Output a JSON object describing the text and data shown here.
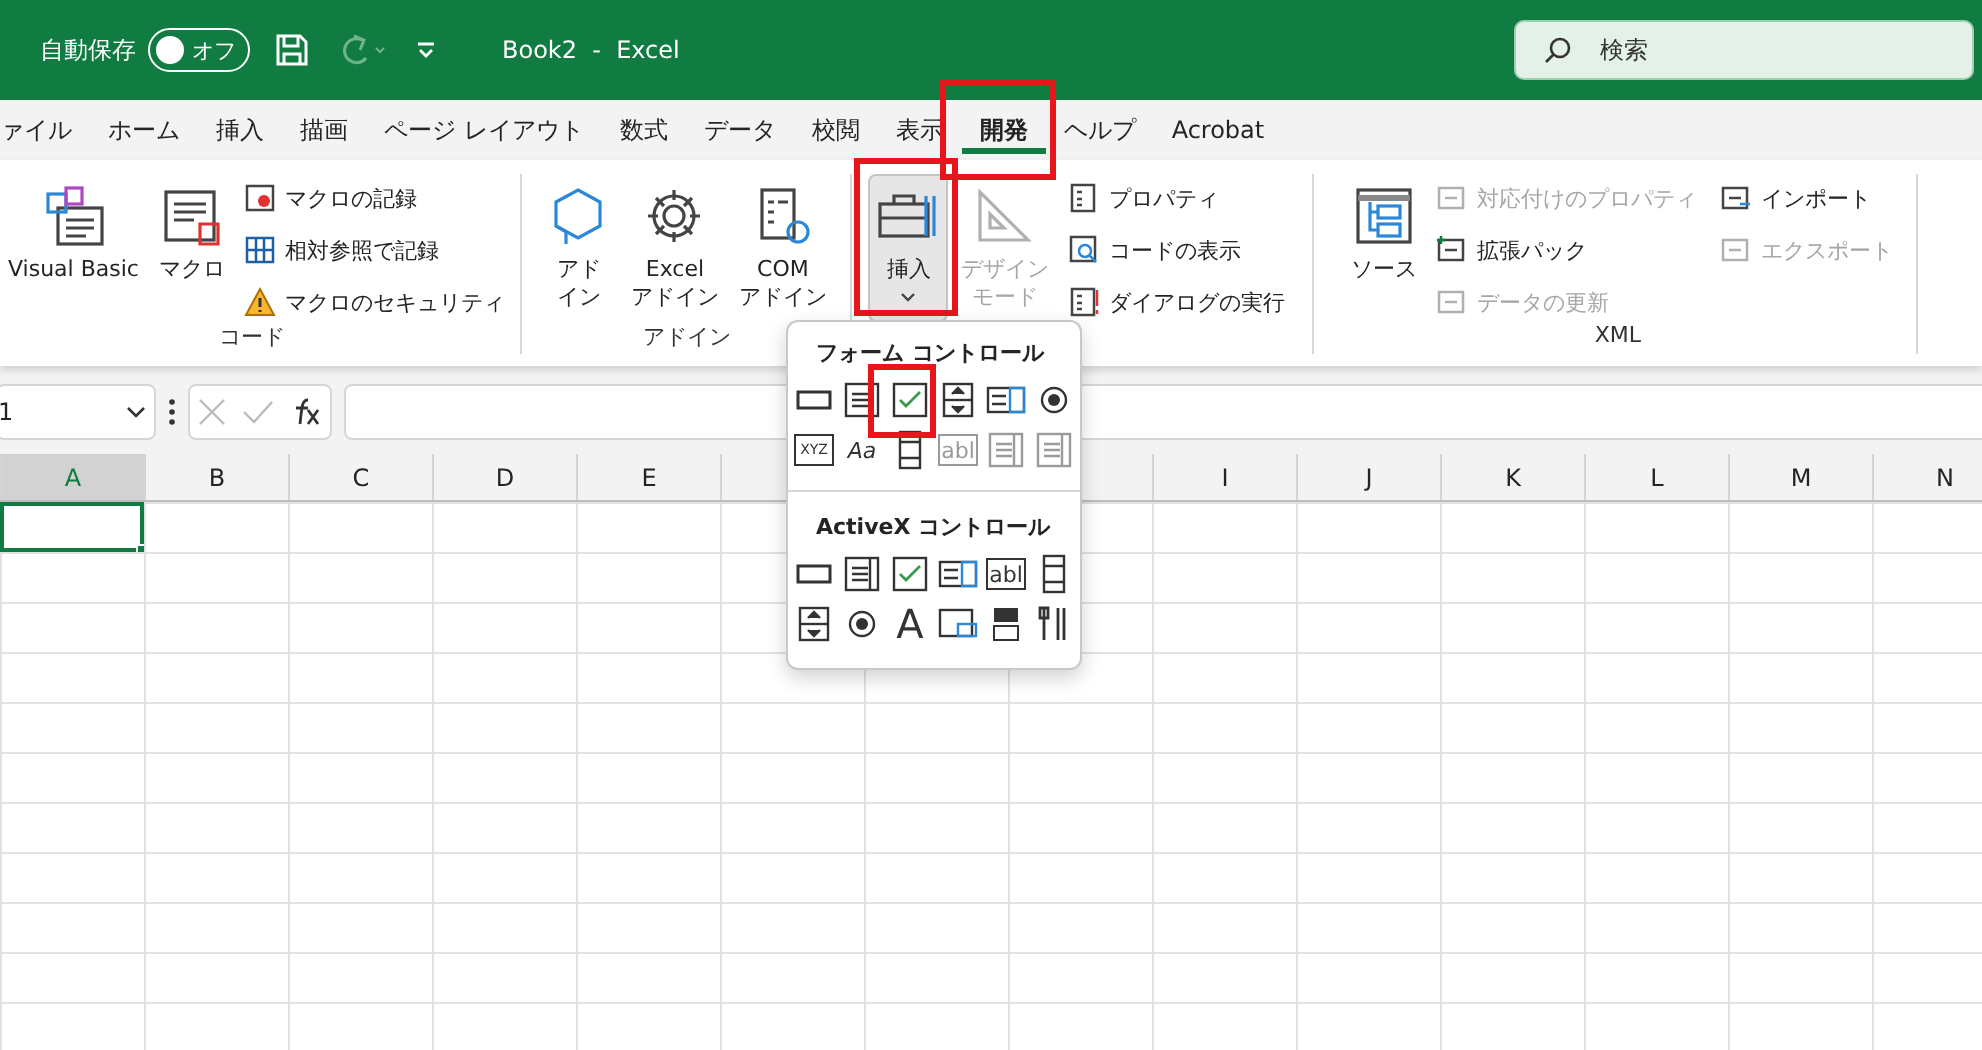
{
  "title_bar": {
    "autosave_label": "自動保存",
    "autosave_toggle": {
      "on": false,
      "label": "オフ"
    },
    "document_title": "Book2  -  Excel",
    "search": {
      "placeholder": "検索"
    }
  },
  "tabs": [
    {
      "label": "ァイル",
      "selected": false,
      "highlighted": false
    },
    {
      "label": "ホーム",
      "selected": false,
      "highlighted": false
    },
    {
      "label": "挿入",
      "selected": false,
      "highlighted": false
    },
    {
      "label": "描画",
      "selected": false,
      "highlighted": false
    },
    {
      "label": "ページ レイアウト",
      "selected": false,
      "highlighted": false
    },
    {
      "label": "数式",
      "selected": false,
      "highlighted": false
    },
    {
      "label": "データ",
      "selected": false,
      "highlighted": false
    },
    {
      "label": "校閲",
      "selected": false,
      "highlighted": false
    },
    {
      "label": "表示",
      "selected": false,
      "highlighted": false
    },
    {
      "label": "開発",
      "selected": true,
      "highlighted": true
    },
    {
      "label": "ヘルプ",
      "selected": false,
      "highlighted": false
    },
    {
      "label": "Acrobat",
      "selected": false,
      "highlighted": false
    }
  ],
  "ribbon_groups": [
    {
      "label": "コード",
      "large": [
        {
          "kind": "vba",
          "lines": [
            "Visual Basic"
          ],
          "disabled": false,
          "pressed": false,
          "highlighted": false
        },
        {
          "kind": "macro",
          "lines": [
            "マクロ"
          ],
          "disabled": false,
          "pressed": false,
          "highlighted": false
        }
      ],
      "small_columns": [
        [
          {
            "kind": "record",
            "label": "マクロの記録",
            "disabled": false
          },
          {
            "kind": "relative",
            "label": "相対参照で記録",
            "disabled": false
          },
          {
            "kind": "warning",
            "label": "マクロのセキュリティ",
            "disabled": false
          }
        ]
      ]
    },
    {
      "label": "アドイン",
      "large": [
        {
          "kind": "addin",
          "lines": [
            "アド",
            "イン"
          ],
          "disabled": false,
          "pressed": false,
          "highlighted": false
        },
        {
          "kind": "gear",
          "lines": [
            "Excel",
            "アドイン"
          ],
          "disabled": false,
          "pressed": false,
          "highlighted": false
        },
        {
          "kind": "com",
          "lines": [
            "COM",
            "アドイン"
          ],
          "disabled": false,
          "pressed": false,
          "highlighted": false
        }
      ]
    },
    {
      "large": [
        {
          "kind": "toolbox",
          "lines": [
            "挿入"
          ],
          "disabled": false,
          "pressed": true,
          "highlighted": true,
          "dropdown": true
        },
        {
          "kind": "triangle",
          "lines": [
            "デザイン",
            "モード"
          ],
          "disabled": true,
          "pressed": false,
          "highlighted": false
        }
      ],
      "small_columns": [
        [
          {
            "kind": "properties",
            "label": "プロパティ",
            "disabled": false
          },
          {
            "kind": "viewcode",
            "label": "コードの表示",
            "disabled": false
          },
          {
            "kind": "dialog",
            "label": "ダイアログの実行",
            "disabled": false
          }
        ]
      ]
    },
    {
      "label": "XML",
      "large": [
        {
          "kind": "source",
          "lines": [
            "ソース"
          ],
          "disabled": false,
          "pressed": false,
          "highlighted": false
        }
      ],
      "small_columns": [
        [
          {
            "kind": "mapprops",
            "label": "対応付けのプロパティ",
            "disabled": true
          },
          {
            "kind": "expansion",
            "label": "拡張パック",
            "disabled": false
          },
          {
            "kind": "refresh",
            "label": "データの更新",
            "disabled": true
          }
        ],
        [
          {
            "kind": "import",
            "label": "インポート",
            "disabled": false
          },
          {
            "kind": "export",
            "label": "エクスポート",
            "disabled": true
          }
        ]
      ]
    }
  ],
  "formula_bar": {
    "name_box": "1"
  },
  "columns": [
    {
      "label": "A",
      "selected": true
    },
    {
      "label": "B",
      "selected": false
    },
    {
      "label": "C",
      "selected": false
    },
    {
      "label": "D",
      "selected": false
    },
    {
      "label": "E",
      "selected": false
    },
    null,
    null,
    null,
    {
      "label": "I",
      "selected": false
    },
    {
      "label": "J",
      "selected": false
    },
    {
      "label": "K",
      "selected": false
    },
    {
      "label": "L",
      "selected": false
    },
    {
      "label": "M",
      "selected": false
    },
    {
      "label": "N",
      "selected": false
    }
  ],
  "controls_menu": [
    {
      "title": "フォーム コントロール",
      "controls": [
        {
          "kind": "button",
          "disabled": false,
          "highlighted": false
        },
        {
          "kind": "combo",
          "disabled": false,
          "highlighted": false
        },
        {
          "kind": "checkbox",
          "disabled": false,
          "highlighted": true
        },
        {
          "kind": "spin",
          "disabled": false,
          "highlighted": false
        },
        {
          "kind": "list",
          "disabled": false,
          "highlighted": false
        },
        {
          "kind": "option",
          "disabled": false,
          "highlighted": false
        },
        {
          "kind": "group",
          "glyph": "XYZ",
          "disabled": false,
          "highlighted": false
        },
        {
          "kind": "label",
          "glyph": "Aa",
          "disabled": false,
          "highlighted": false
        },
        {
          "kind": "scroll",
          "disabled": false,
          "highlighted": false
        },
        {
          "kind": "textbox",
          "glyph": "abl",
          "disabled": true,
          "highlighted": false
        },
        {
          "kind": "combolist",
          "disabled": true,
          "highlighted": false
        },
        {
          "kind": "combodrop",
          "disabled": true,
          "highlighted": false
        }
      ]
    },
    {
      "title": "ActiveX コントロール",
      "controls": [
        {
          "kind": "button",
          "disabled": false,
          "highlighted": false
        },
        {
          "kind": "combo",
          "disabled": false,
          "highlighted": false
        },
        {
          "kind": "checkbox",
          "disabled": false,
          "highlighted": false
        },
        {
          "kind": "list",
          "disabled": false,
          "highlighted": false
        },
        {
          "kind": "textbox",
          "glyph": "abl",
          "disabled": false,
          "highlighted": false
        },
        {
          "kind": "scroll",
          "disabled": false,
          "highlighted": false
        },
        {
          "kind": "spin",
          "disabled": false,
          "highlighted": false
        },
        {
          "kind": "option",
          "disabled": false,
          "highlighted": false
        },
        {
          "kind": "biglabel",
          "glyph": "A",
          "disabled": false,
          "highlighted": false
        },
        {
          "kind": "image",
          "disabled": false,
          "highlighted": false
        },
        {
          "kind": "toggle",
          "disabled": false,
          "highlighted": false
        },
        {
          "kind": "more",
          "disabled": false,
          "highlighted": false
        }
      ]
    }
  ]
}
